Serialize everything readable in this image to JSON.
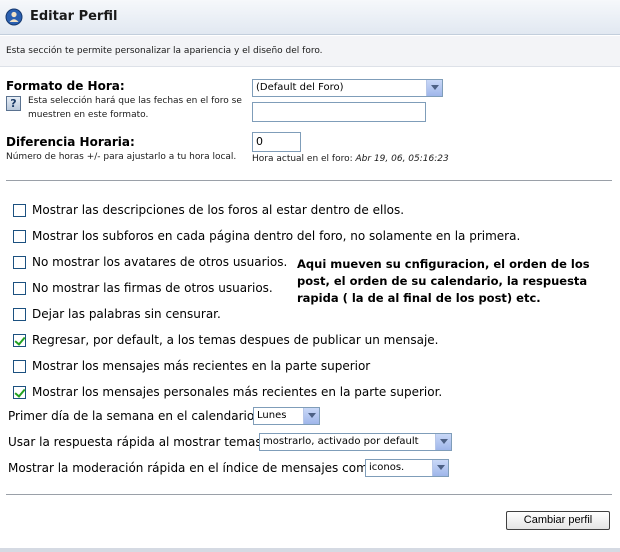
{
  "header": {
    "title": "Editar Perfil"
  },
  "description": "Esta sección te permite personalizar la apariencia y el diseño del foro.",
  "time_format": {
    "label": "Formato de Hora:",
    "help_line1": "Esta selección hará que las fechas en el foro se",
    "help_line2": "muestren en este formato.",
    "select_value": "(Default del Foro)",
    "custom_value": ""
  },
  "time_offset": {
    "label": "Diferencia Horaria:",
    "help": "Número de horas +/- para ajustarlo a tu hora local.",
    "value": "0",
    "current_time_label": "Hora actual en el foro:",
    "current_time_value": "Abr 19, 06, 05:16:23"
  },
  "options": [
    {
      "label": "Mostrar las descripciones de los foros al estar dentro de ellos.",
      "checked": false
    },
    {
      "label": "Mostrar los subforos en cada página dentro del foro, no solamente en la primera.",
      "checked": false
    },
    {
      "label": "No mostrar los avatares de otros usuarios.",
      "checked": false
    },
    {
      "label": "No mostrar las firmas de otros usuarios.",
      "checked": false
    },
    {
      "label": "Dejar las palabras sin censurar.",
      "checked": false
    },
    {
      "label": "Regresar, por default, a los temas despues de publicar un mensaje.",
      "checked": true
    },
    {
      "label": "Mostrar los mensajes más recientes en la parte superior",
      "checked": false
    },
    {
      "label": "Mostrar los mensajes personales más recientes en la parte superior.",
      "checked": true
    }
  ],
  "first_day": {
    "label": "Primer día de la semana en el calendario:",
    "value": "Lunes"
  },
  "quick_reply": {
    "label": "Usar la respuesta rápida al mostrar temas:",
    "value": "mostrarlo, activado por default"
  },
  "quick_mod": {
    "label": "Mostrar la moderación rápida en el índice de mensajes como",
    "value": "iconos."
  },
  "annotation": {
    "line1": "Aqui mueven su cnfiguracion, el orden de los",
    "line2": "post, el orden de su calendario, la respuesta",
    "line3": "rapida ( la de al final de los post) etc."
  },
  "submit_label": "Cambiar perfil"
}
